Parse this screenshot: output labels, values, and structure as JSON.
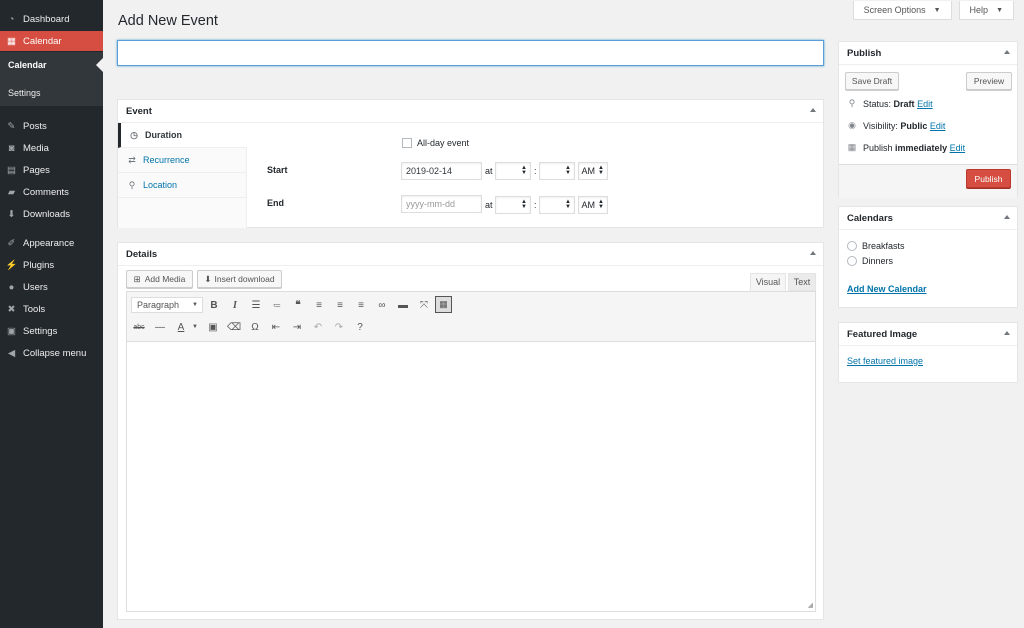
{
  "sidebar": {
    "items": [
      {
        "label": "Dashboard",
        "icon": "dashboard-icon"
      },
      {
        "label": "Calendar",
        "icon": "calendar-icon"
      },
      {
        "label": "Posts",
        "icon": "pin-icon"
      },
      {
        "label": "Media",
        "icon": "media-icon"
      },
      {
        "label": "Pages",
        "icon": "pages-icon"
      },
      {
        "label": "Comments",
        "icon": "comments-icon"
      },
      {
        "label": "Downloads",
        "icon": "download-icon"
      },
      {
        "label": "Appearance",
        "icon": "brush-icon"
      },
      {
        "label": "Plugins",
        "icon": "plugin-icon"
      },
      {
        "label": "Users",
        "icon": "users-icon"
      },
      {
        "label": "Tools",
        "icon": "wrench-icon"
      },
      {
        "label": "Settings",
        "icon": "settings-icon"
      },
      {
        "label": "Collapse menu",
        "icon": "collapse-icon"
      }
    ],
    "submenu": [
      "Calendar",
      "Settings"
    ]
  },
  "top": {
    "screen_options": "Screen Options",
    "help": "Help"
  },
  "page": {
    "title": "Add New Event",
    "title_value": ""
  },
  "event_box": {
    "title": "Event",
    "tabs": [
      "Duration",
      "Recurrence",
      "Location"
    ],
    "all_day": "All-day event",
    "start_label": "Start",
    "end_label": "End",
    "start_date": "2019-02-14",
    "end_placeholder": "yyyy-mm-dd",
    "at": "at",
    "colon": ":",
    "ampm": "AM"
  },
  "details_box": {
    "title": "Details",
    "add_media": "Add Media",
    "insert_download": "Insert download",
    "tab_visual": "Visual",
    "tab_text": "Text",
    "format": "Paragraph"
  },
  "publish": {
    "title": "Publish",
    "save_draft": "Save Draft",
    "preview": "Preview",
    "status_label": "Status:",
    "status": "Draft",
    "visibility_label": "Visibility:",
    "visibility": "Public",
    "publish_label": "Publish",
    "publish_when": "immediately",
    "edit": "Edit",
    "publish_btn": "Publish"
  },
  "calendars": {
    "title": "Calendars",
    "options": [
      "Breakfasts",
      "Dinners"
    ],
    "add_new": "Add New Calendar"
  },
  "featured": {
    "title": "Featured Image",
    "link": "Set featured image"
  },
  "colors": {
    "accent": "#d54e41",
    "sidebar": "#23282d",
    "link": "#0073aa"
  }
}
